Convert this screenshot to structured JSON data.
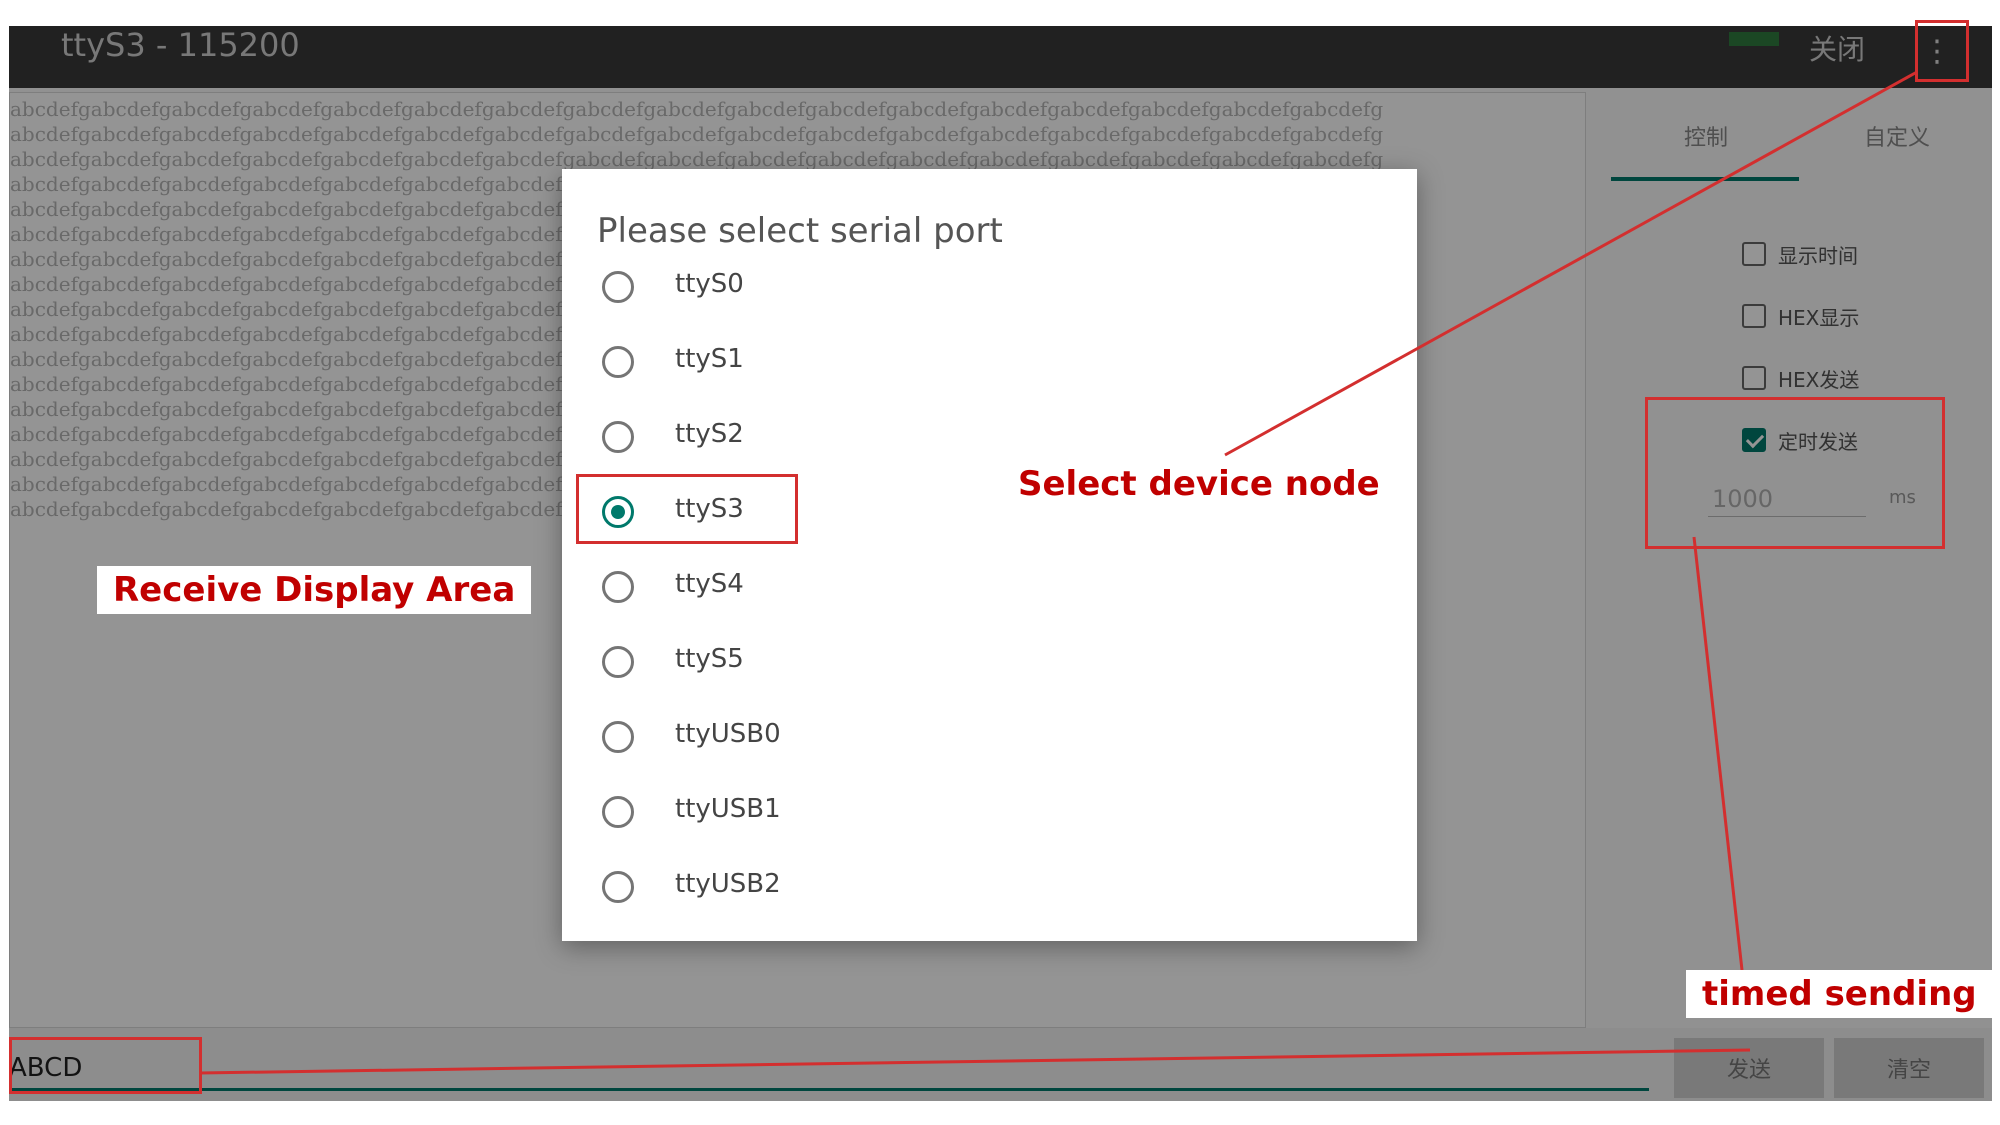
{
  "app": {
    "title": "ttyS3 - 115200",
    "close_label": "关闭",
    "menu_icon": "⋮"
  },
  "receive": {
    "line_text": "abcdefgabcdefgabcdefgabcdefgabcdefgabcdefgabcdefgabcdefgabcdefgabcdefgabcdefgabcdefgabcdefgabcdefgabcdefgabcdefgabcdefg"
  },
  "panel": {
    "tabs": [
      {
        "label": "控制",
        "active": true
      },
      {
        "label": "自定义",
        "active": false
      }
    ],
    "options": [
      {
        "label": "显示时间",
        "checked": false
      },
      {
        "label": "HEX显示",
        "checked": false
      },
      {
        "label": "HEX发送",
        "checked": false
      },
      {
        "label": "定时发送",
        "checked": true
      }
    ],
    "interval_value": "1000",
    "interval_unit": "ms"
  },
  "bottom": {
    "send_text": "ABCD",
    "send_label": "发送",
    "clear_label": "清空"
  },
  "dialog": {
    "title": "Please select serial port",
    "ports": [
      {
        "name": "ttyS0",
        "selected": false
      },
      {
        "name": "ttyS1",
        "selected": false
      },
      {
        "name": "ttyS2",
        "selected": false
      },
      {
        "name": "ttyS3",
        "selected": true
      },
      {
        "name": "ttyS4",
        "selected": false
      },
      {
        "name": "ttyS5",
        "selected": false
      },
      {
        "name": "ttyUSB0",
        "selected": false
      },
      {
        "name": "ttyUSB1",
        "selected": false
      },
      {
        "name": "ttyUSB2",
        "selected": false
      }
    ]
  },
  "annotations": {
    "select_device_node": "Select device node",
    "receive_display_area": "Receive Display Area",
    "timed_sending": "timed sending",
    "color": "#d32f2f"
  },
  "colors": {
    "accent": "#00796b",
    "titlebar": "#3a3a3a"
  }
}
